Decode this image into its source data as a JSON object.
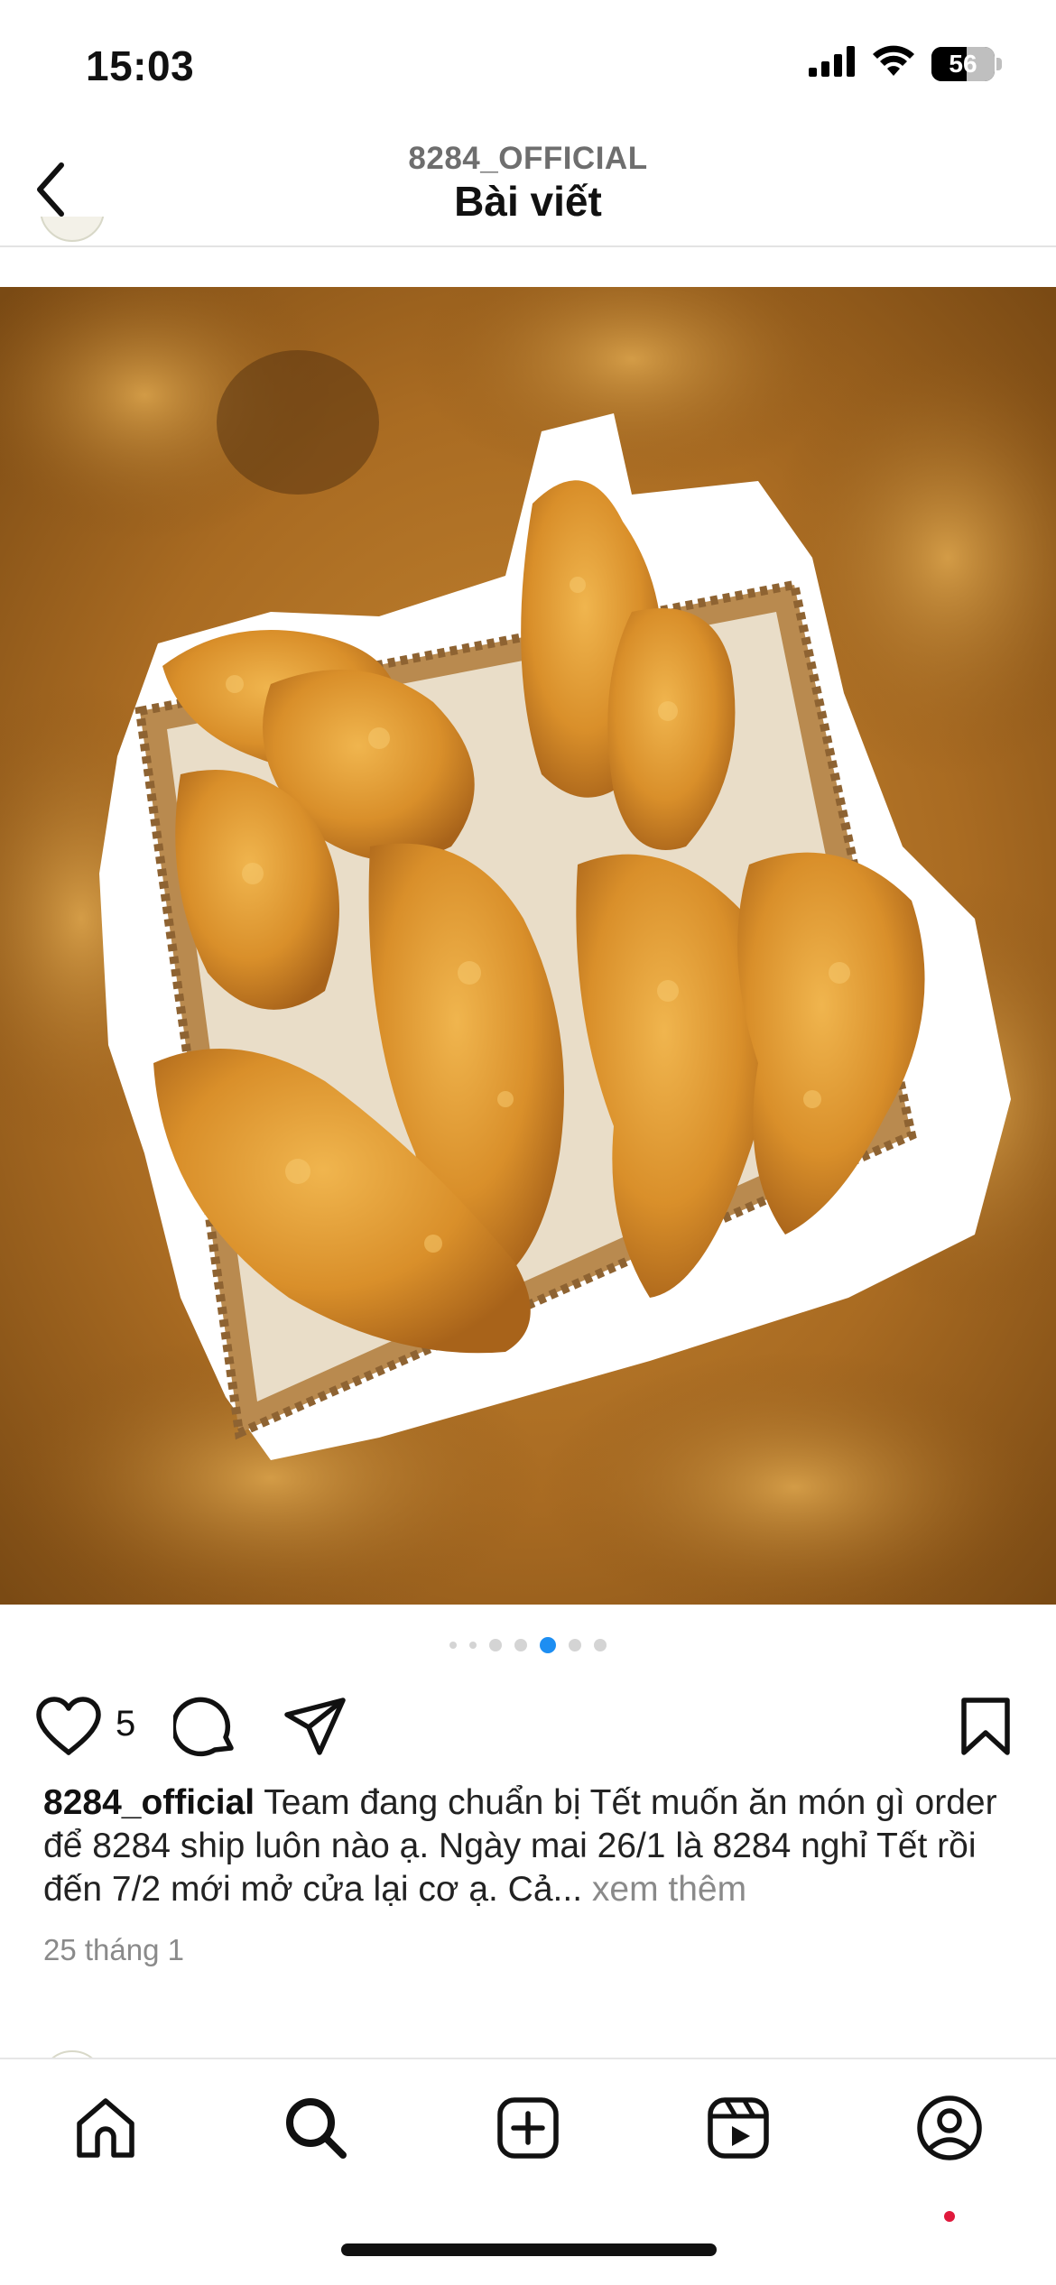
{
  "status_bar": {
    "time": "15:03",
    "battery": "56",
    "battery_level": 0.56,
    "icons": [
      "signal-icon",
      "wifi-icon",
      "battery-icon"
    ]
  },
  "header": {
    "account": "8284_OFFICIAL",
    "title": "Bài viết",
    "back_icon": "chevron-left-icon"
  },
  "post": {
    "image_alt": "Fried chicken in a woven basket",
    "carousel": {
      "count": 7,
      "active_index": 4
    },
    "likes": "5",
    "caption_user": "8284_official",
    "caption_text": "Team đang chuẩn bị Tết muốn ăn món gì order để 8284 ship luôn nào ạ. Ngày mai 26/1 là 8284 nghỉ Tết rồi đến 7/2 mới mở cửa lại cơ ạ. Cả...",
    "more_label": "xem thêm",
    "date": "25 tháng 1",
    "icons": [
      "heart-icon",
      "comment-icon",
      "share-icon",
      "bookmark-icon"
    ]
  },
  "tab_bar": {
    "items": [
      "home-icon",
      "search-icon",
      "create-icon",
      "reels-icon",
      "profile-icon"
    ],
    "active": "search-icon",
    "colors": {
      "notification": "#e0193c",
      "active_dot": "#1d8ef2"
    }
  }
}
